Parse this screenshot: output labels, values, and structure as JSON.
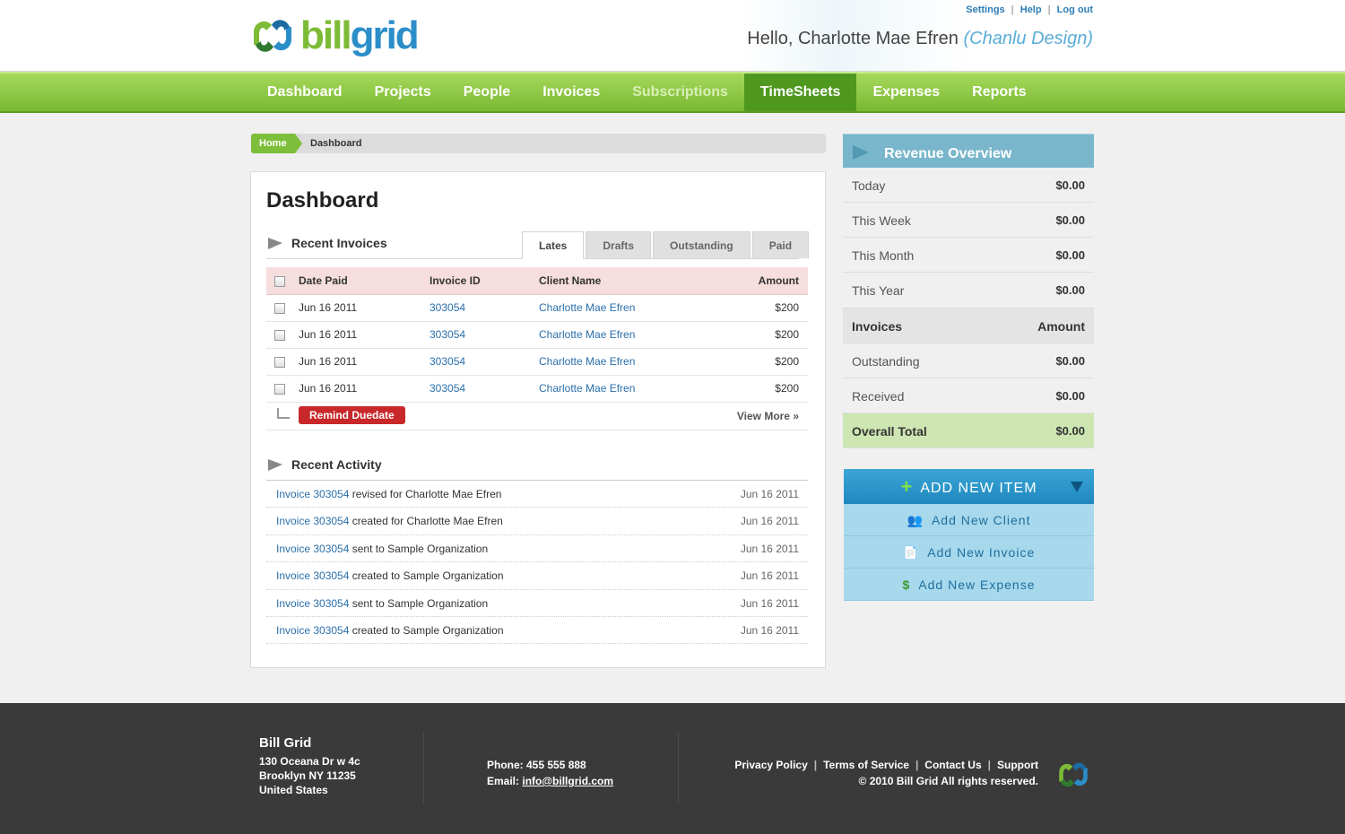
{
  "brand": {
    "logo_part1": "bill",
    "logo_part2": "grid"
  },
  "top_links": {
    "settings": "Settings",
    "help": "Help",
    "logout": "Log out",
    "sep": "|"
  },
  "greeting": {
    "text": "Hello, Charlotte Mae Efren",
    "org": "(Chanlu Design)"
  },
  "nav": [
    {
      "label": "Dashboard"
    },
    {
      "label": "Projects"
    },
    {
      "label": "People"
    },
    {
      "label": "Invoices"
    },
    {
      "label": "Subscriptions"
    },
    {
      "label": "TimeSheets"
    },
    {
      "label": "Expenses"
    },
    {
      "label": "Reports"
    }
  ],
  "breadcrumb": {
    "home": "Home",
    "current": "Dashboard"
  },
  "main": {
    "title": "Dashboard",
    "recent_invoices": {
      "title": "Recent Invoices",
      "tabs": [
        "Lates",
        "Drafts",
        "Outstanding",
        "Paid"
      ],
      "active_tab": "Lates",
      "columns": [
        "Date Paid",
        "Invoice ID",
        "Client Name",
        "Amount"
      ],
      "rows": [
        {
          "date": "Jun 16 2011",
          "id": "303054",
          "client": "Charlotte Mae Efren",
          "amount": "$200"
        },
        {
          "date": "Jun 16 2011",
          "id": "303054",
          "client": "Charlotte Mae Efren",
          "amount": "$200"
        },
        {
          "date": "Jun 16 2011",
          "id": "303054",
          "client": "Charlotte Mae Efren",
          "amount": "$200"
        },
        {
          "date": "Jun 16 2011",
          "id": "303054",
          "client": "Charlotte Mae Efren",
          "amount": "$200"
        }
      ],
      "remind_button": "Remind Duedate",
      "view_more": "View More »"
    },
    "recent_activity": {
      "title": "Recent Activity",
      "items": [
        {
          "link": "Invoice 303054",
          "text": " revised for Charlotte Mae Efren",
          "date": "Jun 16 2011"
        },
        {
          "link": "Invoice 303054",
          "text": " created for Charlotte Mae Efren",
          "date": "Jun 16 2011"
        },
        {
          "link": "Invoice 303054",
          "text": " sent to Sample Organization",
          "date": "Jun 16 2011"
        },
        {
          "link": "Invoice 303054",
          "text": " created to Sample Organization",
          "date": "Jun 16 2011"
        },
        {
          "link": "Invoice 303054",
          "text": " sent to Sample Organization",
          "date": "Jun 16 2011"
        },
        {
          "link": "Invoice 303054",
          "text": " created to Sample Organization",
          "date": "Jun 16 2011"
        }
      ]
    }
  },
  "revenue": {
    "title": "Revenue Overview",
    "rows": [
      {
        "label": "Today",
        "value": "$0.00"
      },
      {
        "label": "This Week",
        "value": "$0.00"
      },
      {
        "label": "This Month",
        "value": "$0.00"
      },
      {
        "label": "This Year",
        "value": "$0.00"
      }
    ],
    "inv_header": {
      "label": "Invoices",
      "value": "Amount"
    },
    "inv_rows": [
      {
        "label": "Outstanding",
        "value": "$0.00"
      },
      {
        "label": "Received",
        "value": "$0.00"
      }
    ],
    "total": {
      "label": "Overall Total",
      "value": "$0.00"
    }
  },
  "add_new": {
    "title": "ADD NEW ITEM",
    "items": [
      {
        "label": "Add New Client",
        "icon": "client-icon"
      },
      {
        "label": "Add New Invoice",
        "icon": "document-icon"
      },
      {
        "label": "Add New Expense",
        "icon": "dollar-icon"
      }
    ]
  },
  "footer": {
    "company": "Bill Grid",
    "address1": "130 Oceana Dr w 4c",
    "address2": "Brooklyn NY 11235",
    "address3": "United States",
    "phone": "Phone: 455 555 888",
    "email_label": "Email: ",
    "email": "info@billgrid.com",
    "links": [
      "Privacy Policy",
      "Terms of Service",
      "Contact Us",
      "Support"
    ],
    "copyright": "© 2010 Bill Grid All rights reserved."
  },
  "colors": {
    "nav_green": "#7ab931",
    "nav_active": "#4f9820",
    "link_blue": "#2a6faa",
    "revenue_head": "#79b6cb",
    "add_head": "#1f87bf",
    "remind_red": "#c8282a"
  }
}
